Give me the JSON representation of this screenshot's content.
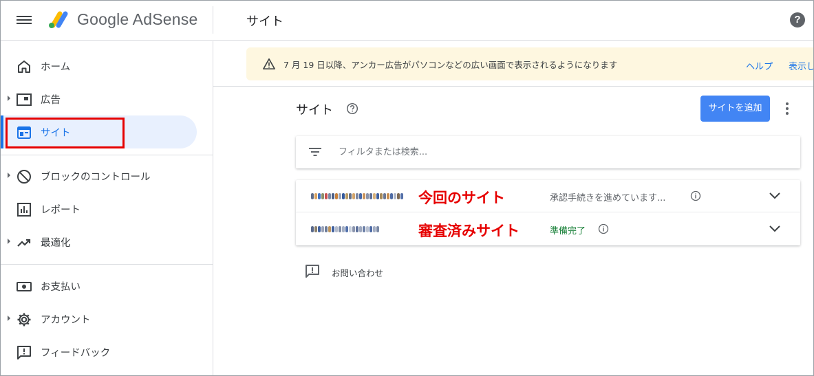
{
  "header": {
    "brand": "Google AdSense",
    "page_title": "サイト",
    "help_glyph": "?"
  },
  "sidebar": {
    "items": [
      {
        "label": "ホーム",
        "icon": "home-icon"
      },
      {
        "label": "広告",
        "icon": "ads-icon"
      },
      {
        "label": "サイト",
        "icon": "sites-icon",
        "active": true
      },
      {
        "label": "ブロックのコントロール",
        "icon": "block-icon"
      },
      {
        "label": "レポート",
        "icon": "report-icon"
      },
      {
        "label": "最適化",
        "icon": "trending-up-icon"
      },
      {
        "label": "お支払い",
        "icon": "payments-icon"
      },
      {
        "label": "アカウント",
        "icon": "gear-icon"
      },
      {
        "label": "フィードバック",
        "icon": "feedback-icon"
      }
    ]
  },
  "notice": {
    "message": "7 月 19 日以降、アンカー広告がパソコンなどの広い画面で表示されるようになります",
    "help_link": "ヘルプ",
    "show_link": "表示し"
  },
  "main": {
    "heading": "サイト",
    "add_button": "サイトを追加",
    "filter_placeholder": "フィルタまたは検索...",
    "sites": [
      {
        "annotation": "今回のサイト",
        "status": "承認手続きを進めています..."
      },
      {
        "annotation": "審査済みサイト",
        "status": "準備完了"
      }
    ],
    "contact": "お問い合わせ"
  },
  "colors": {
    "accent": "#1a73e8",
    "button": "#4285f4",
    "notice_bg": "#fef7e0",
    "annotation_red": "#e60000",
    "ready_green": "#188038"
  }
}
